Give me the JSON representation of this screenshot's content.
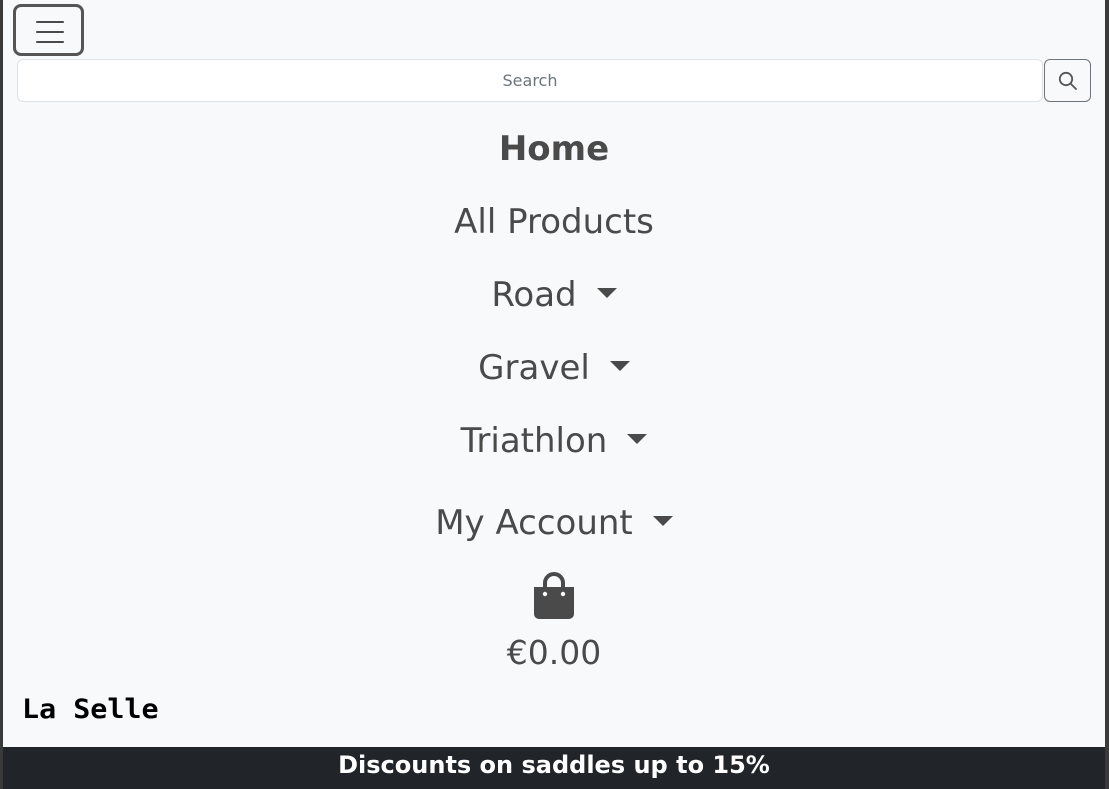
{
  "toolbar": {
    "menu_toggle_icon": "hamburger-menu-icon"
  },
  "search": {
    "placeholder": "Search",
    "value": "",
    "button_icon": "magnifier-icon"
  },
  "nav": {
    "home": "Home",
    "all_products": "All Products",
    "road": "Road",
    "gravel": "Gravel",
    "triathlon": "Triathlon",
    "my_account": "My Account",
    "dropdown_icon": "caret-down-icon"
  },
  "bag": {
    "icon": "shopping-bag-icon",
    "total": "€0.00"
  },
  "brand": {
    "logo_text": "La Selle"
  },
  "banner": {
    "text": "Discounts on saddles up to 15%"
  },
  "colors": {
    "page_background": "#f8f9fa",
    "text": "#4a4a4a",
    "banner_background": "#212529",
    "banner_text": "#ffffff"
  }
}
